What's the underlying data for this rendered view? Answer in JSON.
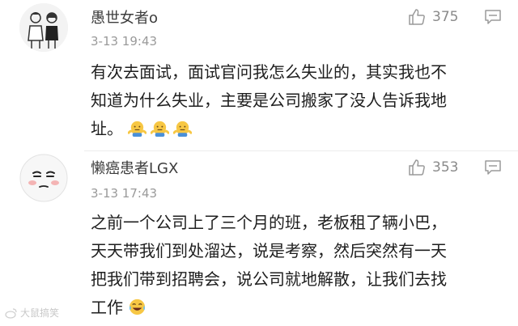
{
  "comments": [
    {
      "username": "愚世女者o",
      "time": "3-13 19:43",
      "likes": "375",
      "body_lines": [
        "有次去面试，面试官问我怎么失业的，其实我也不",
        "知道为什么失业，主要是公司搬家了没人告诉我地",
        "址。"
      ],
      "emoji": [
        "shrug-emoji",
        "shrug-emoji",
        "shrug-emoji"
      ]
    },
    {
      "username": "懒癌患者LGX",
      "time": "3-13 17:43",
      "likes": "353",
      "body_lines": [
        "之前一个公司上了三个月的班，老板租了辆小巴，",
        "天天带我们到处溜达，说是考察，然后突然有一天",
        "把我们带到招聘会，说公司就地解散，让我们去找",
        "工作"
      ],
      "emoji": [
        "laugh-cry-emoji"
      ]
    }
  ],
  "watermark": "大鼠搞笑"
}
